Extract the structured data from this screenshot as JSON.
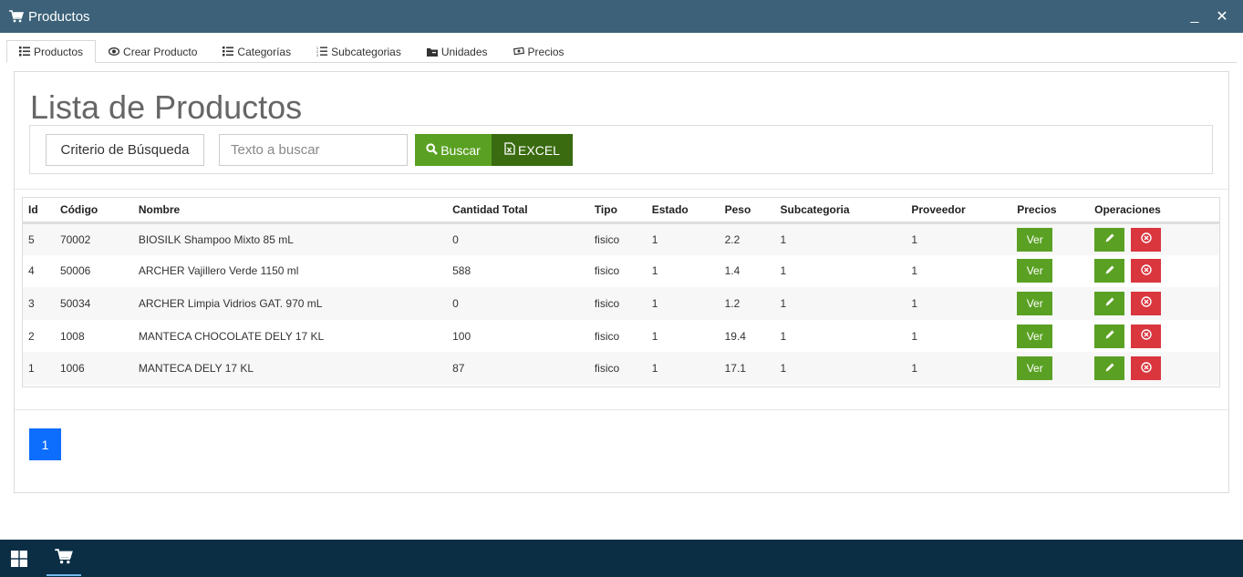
{
  "window": {
    "title": "Productos",
    "minimize": "_",
    "close": "✕"
  },
  "tabs": [
    {
      "label": "Productos",
      "icon": "list-icon"
    },
    {
      "label": "Crear Producto",
      "icon": "eye-icon"
    },
    {
      "label": "Categorías",
      "icon": "list-icon"
    },
    {
      "label": "Subcategorias",
      "icon": "numbered-list-icon"
    },
    {
      "label": "Unidades",
      "icon": "folder-icon"
    },
    {
      "label": "Precios",
      "icon": "money-icon"
    }
  ],
  "main": {
    "title": "Lista de Productos",
    "search": {
      "criteria_label": "Criterio de Búsqueda",
      "placeholder": "Texto a buscar",
      "search_button": "Buscar",
      "excel_button": "EXCEL"
    },
    "table": {
      "headers": [
        "Id",
        "Código",
        "Nombre",
        "Cantidad Total",
        "Tipo",
        "Estado",
        "Peso",
        "Subcategoria",
        "Proveedor",
        "Precios",
        "Operaciones"
      ],
      "view_label": "Ver",
      "rows": [
        {
          "id": "5",
          "codigo": "70002",
          "nombre": "BIOSILK Shampoo Mixto 85 mL",
          "cantidad": "0",
          "tipo": "fisico",
          "estado": "1",
          "peso": "2.2",
          "subcategoria": "1",
          "proveedor": "1"
        },
        {
          "id": "4",
          "codigo": "50006",
          "nombre": "ARCHER Vajillero Verde 1150 ml",
          "cantidad": "588",
          "tipo": "fisico",
          "estado": "1",
          "peso": "1.4",
          "subcategoria": "1",
          "proveedor": "1"
        },
        {
          "id": "3",
          "codigo": "50034",
          "nombre": "ARCHER Limpia Vidrios GAT. 970 mL",
          "cantidad": "0",
          "tipo": "fisico",
          "estado": "1",
          "peso": "1.2",
          "subcategoria": "1",
          "proveedor": "1"
        },
        {
          "id": "2",
          "codigo": "1008",
          "nombre": "MANTECA CHOCOLATE DELY 17 KL",
          "cantidad": "100",
          "tipo": "fisico",
          "estado": "1",
          "peso": "19.4",
          "subcategoria": "1",
          "proveedor": "1"
        },
        {
          "id": "1",
          "codigo": "1006",
          "nombre": "MANTECA DELY 17 KL",
          "cantidad": "87",
          "tipo": "fisico",
          "estado": "1",
          "peso": "17.1",
          "subcategoria": "1",
          "proveedor": "1"
        }
      ]
    },
    "pagination": {
      "current": "1"
    }
  },
  "colors": {
    "titlebar": "#3c6178",
    "green": "#5aa123",
    "dark_green": "#3a6b10",
    "red": "#d9363e",
    "blue": "#0d6efd",
    "taskbar": "#0b2e45"
  }
}
